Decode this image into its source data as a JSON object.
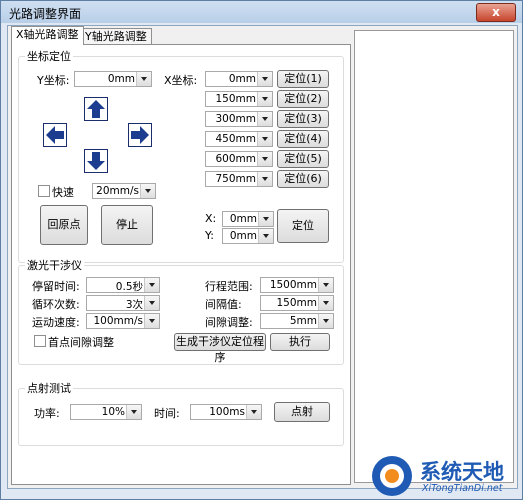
{
  "window": {
    "title": "光路调整界面",
    "close": "x"
  },
  "tabs": [
    {
      "label": "X轴光路调整"
    },
    {
      "label": "Y轴光路调整"
    }
  ],
  "coord": {
    "group_title": "坐标定位",
    "y_label": "Y坐标:",
    "y_value": "0mm",
    "x_label": "X坐标:",
    "x_values": [
      "0mm",
      "150mm",
      "300mm",
      "450mm",
      "600mm",
      "750mm"
    ],
    "locate_buttons": [
      "定位(1)",
      "定位(2)",
      "定位(3)",
      "定位(4)",
      "定位(5)",
      "定位(6)"
    ],
    "fast_label": "快速",
    "speed_value": "20mm/s",
    "home_button": "回原点",
    "stop_button": "停止",
    "x_small_label": "X:",
    "x_small_value": "0mm",
    "y_small_label": "Y:",
    "y_small_value": "0mm",
    "locate_button": "定位"
  },
  "laser": {
    "group_title": "激光干涉仪",
    "stop_time_label": "停留时间:",
    "stop_time_value": "0.5秒",
    "cycles_label": "循环次数:",
    "cycles_value": "3次",
    "speed_label": "运动速度:",
    "speed_value": "100mm/s",
    "range_label": "行程范围:",
    "range_value": "1500mm",
    "interval_label": "间隔值:",
    "interval_value": "150mm",
    "gap_label": "间隙调整:",
    "gap_value": "5mm",
    "first_point_label": "首点间隙调整",
    "generate_button": "生成干涉仪定位程序",
    "execute_button": "执行"
  },
  "spot": {
    "group_title": "点射测试",
    "power_label": "功率:",
    "power_value": "10%",
    "time_label": "时间:",
    "time_value": "100ms",
    "fire_button": "点射"
  },
  "watermark": {
    "brand": "系统天地",
    "url": "XiTongTianDi.net"
  },
  "colors": {
    "arrow_blue": "#1c3d8f",
    "accent": "#1f5bb5"
  }
}
